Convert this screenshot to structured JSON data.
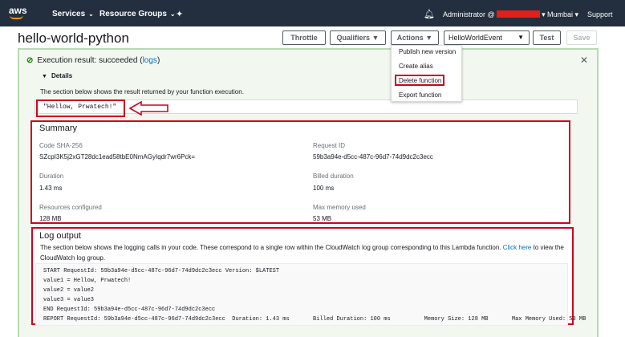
{
  "nav": {
    "brand": "aws",
    "services": "Services",
    "resource_groups": "Resource Groups",
    "account_label": "Administrator @",
    "region": "Mumbai",
    "support": "Support"
  },
  "header": {
    "title": "hello-world-python",
    "throttle": "Throttle",
    "qualifiers": "Qualifiers",
    "actions": "Actions",
    "test_event": "HelloWorldEvent",
    "test": "Test",
    "save": "Save"
  },
  "actions_menu": [
    "Publish new version",
    "Create alias",
    "Delete function",
    "Export function"
  ],
  "result": {
    "heading": "Execution result: succeeded (",
    "logs_link": "logs",
    "heading_close": ")",
    "details": "Details",
    "note": "The section below shows the result returned by your function execution.",
    "output": "\"Hellow, Prwatech!\""
  },
  "summary": {
    "title": "Summary",
    "code_sha_label": "Code SHA-256",
    "code_sha_value": "SZcpI3K5j2xGT28dc1ead58tbE0NmAGyIqdr7wr6Pck=",
    "request_id_label": "Request ID",
    "request_id_value": "59b3a94e-d5cc-487c-96d7-74d9dc2c3ecc",
    "duration_label": "Duration",
    "duration_value": "1.43 ms",
    "billed_label": "Billed duration",
    "billed_value": "100 ms",
    "resources_label": "Resources configured",
    "resources_value": "128 MB",
    "maxmem_label": "Max memory used",
    "maxmem_value": "53 MB"
  },
  "log_output": {
    "title": "Log output",
    "note_a": "The section below shows the logging calls in your code. These correspond to a single row within the CloudWatch log group corresponding to this Lambda function.",
    "note_link": "Click here",
    "note_b": "to view the CloudWatch log group.",
    "lines": [
      "START RequestId: 59b3a94e-d5cc-487c-96d7-74d9dc2c3ecc Version: $LATEST",
      "value1 = Hellow, Prwatech!",
      "value2 = value2",
      "value3 = value3",
      "END RequestId: 59b3a94e-d5cc-487c-96d7-74d9dc2c3ecc",
      "REPORT RequestId: 59b3a94e-d5cc-487c-96d7-74d9dc2c3ecc  Duration: 1.43 ms       Billed Duration: 100 ms          Memory Size: 128 MB       Max Memory Used: 53 MB"
    ]
  },
  "colors": {
    "nav_bg": "#232f3e",
    "aws_orange": "#ff9900",
    "success_green": "#1d8102",
    "link_blue": "#0073bb",
    "annotation_red": "#d0021b"
  }
}
